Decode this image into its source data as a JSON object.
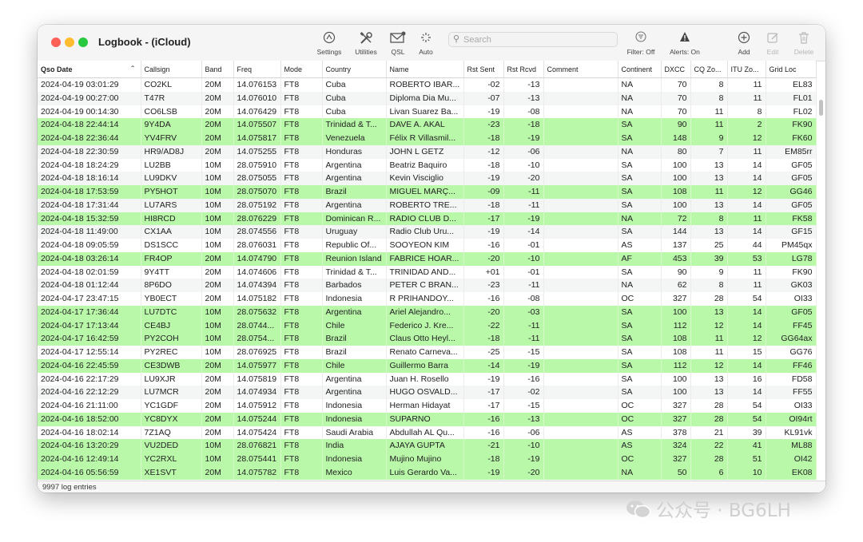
{
  "window": {
    "title": "Logbook - (iCloud)"
  },
  "toolbar": {
    "settings": "Settings",
    "utilities": "Utilities",
    "qsl": "QSL",
    "auto": "Auto",
    "search_placeholder": "Search",
    "filter": "Filter: Off",
    "alerts": "Alerts: On",
    "add": "Add",
    "edit": "Edit",
    "delete": "Delete"
  },
  "table": {
    "columns": [
      "Qso Date",
      "Callsign",
      "Band",
      "Freq",
      "Mode",
      "Country",
      "Name",
      "Rst Sent",
      "Rst Rcvd",
      "Comment",
      "Continent",
      "DXCC",
      "CQ Zo...",
      "ITU Zo...",
      "Grid Loc"
    ],
    "rows": [
      {
        "date": "2024-04-19 03:01:29",
        "call": "CO2KL",
        "band": "20M",
        "freq": "14.076153",
        "mode": "FT8",
        "country": "Cuba",
        "name": "ROBERTO IBAR...",
        "sent": "-02",
        "rcvd": "-13",
        "comment": "",
        "cont": "NA",
        "dxcc": "70",
        "cq": "8",
        "itu": "11",
        "grid": "EL83",
        "hl": false
      },
      {
        "date": "2024-04-19 00:27:00",
        "call": "T47R",
        "band": "20M",
        "freq": "14.076010",
        "mode": "FT8",
        "country": "Cuba",
        "name": "Diploma Dia Mu...",
        "sent": "-07",
        "rcvd": "-13",
        "comment": "",
        "cont": "NA",
        "dxcc": "70",
        "cq": "8",
        "itu": "11",
        "grid": "FL01",
        "hl": false
      },
      {
        "date": "2024-04-19 00:14:30",
        "call": "CO6LSB",
        "band": "20M",
        "freq": "14.076429",
        "mode": "FT8",
        "country": "Cuba",
        "name": "Livan Suarez Ba...",
        "sent": "-19",
        "rcvd": "-08",
        "comment": "",
        "cont": "NA",
        "dxcc": "70",
        "cq": "11",
        "itu": "8",
        "grid": "FL02",
        "hl": false
      },
      {
        "date": "2024-04-18 22:44:14",
        "call": "9Y4DA",
        "band": "20M",
        "freq": "14.075507",
        "mode": "FT8",
        "country": "Trinidad & T...",
        "name": "DAVE A. AKAL",
        "sent": "-23",
        "rcvd": "-18",
        "comment": "",
        "cont": "SA",
        "dxcc": "90",
        "cq": "11",
        "itu": "2",
        "grid": "FK90",
        "hl": true
      },
      {
        "date": "2024-04-18 22:36:44",
        "call": "YV4FRV",
        "band": "20M",
        "freq": "14.075817",
        "mode": "FT8",
        "country": "Venezuela",
        "name": "Félix R Villasmil...",
        "sent": "-18",
        "rcvd": "-19",
        "comment": "",
        "cont": "SA",
        "dxcc": "148",
        "cq": "9",
        "itu": "12",
        "grid": "FK60",
        "hl": true
      },
      {
        "date": "2024-04-18 22:30:59",
        "call": "HR9/AD8J",
        "band": "20M",
        "freq": "14.075255",
        "mode": "FT8",
        "country": "Honduras",
        "name": "JOHN L GETZ",
        "sent": "-12",
        "rcvd": "-06",
        "comment": "",
        "cont": "NA",
        "dxcc": "80",
        "cq": "7",
        "itu": "11",
        "grid": "EM85rr",
        "hl": false
      },
      {
        "date": "2024-04-18 18:24:29",
        "call": "LU2BB",
        "band": "10M",
        "freq": "28.075910",
        "mode": "FT8",
        "country": "Argentina",
        "name": "Beatriz Baquiro",
        "sent": "-18",
        "rcvd": "-10",
        "comment": "",
        "cont": "SA",
        "dxcc": "100",
        "cq": "13",
        "itu": "14",
        "grid": "GF05",
        "hl": false
      },
      {
        "date": "2024-04-18 18:16:14",
        "call": "LU9DKV",
        "band": "10M",
        "freq": "28.075055",
        "mode": "FT8",
        "country": "Argentina",
        "name": "Kevin Visciglio",
        "sent": "-19",
        "rcvd": "-20",
        "comment": "",
        "cont": "SA",
        "dxcc": "100",
        "cq": "13",
        "itu": "14",
        "grid": "GF05",
        "hl": false
      },
      {
        "date": "2024-04-18 17:53:59",
        "call": "PY5HOT",
        "band": "10M",
        "freq": "28.075070",
        "mode": "FT8",
        "country": "Brazil",
        "name": "MIGUEL MARÇ...",
        "sent": "-09",
        "rcvd": "-11",
        "comment": "",
        "cont": "SA",
        "dxcc": "108",
        "cq": "11",
        "itu": "12",
        "grid": "GG46",
        "hl": true
      },
      {
        "date": "2024-04-18 17:31:44",
        "call": "LU7ARS",
        "band": "10M",
        "freq": "28.075192",
        "mode": "FT8",
        "country": "Argentina",
        "name": "ROBERTO TRE...",
        "sent": "-18",
        "rcvd": "-11",
        "comment": "",
        "cont": "SA",
        "dxcc": "100",
        "cq": "13",
        "itu": "14",
        "grid": "GF05",
        "hl": false
      },
      {
        "date": "2024-04-18 15:32:59",
        "call": "HI8RCD",
        "band": "10M",
        "freq": "28.076229",
        "mode": "FT8",
        "country": "Dominican R...",
        "name": "RADIO CLUB D...",
        "sent": "-17",
        "rcvd": "-19",
        "comment": "",
        "cont": "NA",
        "dxcc": "72",
        "cq": "8",
        "itu": "11",
        "grid": "FK58",
        "hl": true
      },
      {
        "date": "2024-04-18 11:49:00",
        "call": "CX1AA",
        "band": "10M",
        "freq": "28.074556",
        "mode": "FT8",
        "country": "Uruguay",
        "name": "Radio Club Uru...",
        "sent": "-19",
        "rcvd": "-14",
        "comment": "",
        "cont": "SA",
        "dxcc": "144",
        "cq": "13",
        "itu": "14",
        "grid": "GF15",
        "hl": false
      },
      {
        "date": "2024-04-18 09:05:59",
        "call": "DS1SCC",
        "band": "10M",
        "freq": "28.076031",
        "mode": "FT8",
        "country": "Republic Of...",
        "name": "SOOYEON KIM",
        "sent": "-16",
        "rcvd": "-01",
        "comment": "",
        "cont": "AS",
        "dxcc": "137",
        "cq": "25",
        "itu": "44",
        "grid": "PM45qx",
        "hl": false
      },
      {
        "date": "2024-04-18 03:26:14",
        "call": "FR4OP",
        "band": "20M",
        "freq": "14.074790",
        "mode": "FT8",
        "country": "Reunion Island",
        "name": "FABRICE HOAR...",
        "sent": "-20",
        "rcvd": "-10",
        "comment": "",
        "cont": "AF",
        "dxcc": "453",
        "cq": "39",
        "itu": "53",
        "grid": "LG78",
        "hl": true
      },
      {
        "date": "2024-04-18 02:01:59",
        "call": "9Y4TT",
        "band": "20M",
        "freq": "14.074606",
        "mode": "FT8",
        "country": "Trinidad & T...",
        "name": "TRINIDAD AND...",
        "sent": "+01",
        "rcvd": "-01",
        "comment": "",
        "cont": "SA",
        "dxcc": "90",
        "cq": "9",
        "itu": "11",
        "grid": "FK90",
        "hl": false
      },
      {
        "date": "2024-04-18 01:12:44",
        "call": "8P6DO",
        "band": "20M",
        "freq": "14.074394",
        "mode": "FT8",
        "country": "Barbados",
        "name": "PETER C BRAN...",
        "sent": "-23",
        "rcvd": "-11",
        "comment": "",
        "cont": "NA",
        "dxcc": "62",
        "cq": "8",
        "itu": "11",
        "grid": "GK03",
        "hl": false
      },
      {
        "date": "2024-04-17 23:47:15",
        "call": "YB0ECT",
        "band": "20M",
        "freq": "14.075182",
        "mode": "FT8",
        "country": "Indonesia",
        "name": "R PRIHANDOY...",
        "sent": "-16",
        "rcvd": "-08",
        "comment": "",
        "cont": "OC",
        "dxcc": "327",
        "cq": "28",
        "itu": "54",
        "grid": "OI33",
        "hl": false
      },
      {
        "date": "2024-04-17 17:36:44",
        "call": "LU7DTC",
        "band": "10M",
        "freq": "28.075632",
        "mode": "FT8",
        "country": "Argentina",
        "name": "Ariel Alejandro...",
        "sent": "-20",
        "rcvd": "-03",
        "comment": "",
        "cont": "SA",
        "dxcc": "100",
        "cq": "13",
        "itu": "14",
        "grid": "GF05",
        "hl": true
      },
      {
        "date": "2024-04-17 17:13:44",
        "call": "CE4BJ",
        "band": "10M",
        "freq": "28.0744...",
        "mode": "FT8",
        "country": "Chile",
        "name": "Federico J. Kre...",
        "sent": "-22",
        "rcvd": "-11",
        "comment": "",
        "cont": "SA",
        "dxcc": "112",
        "cq": "12",
        "itu": "14",
        "grid": "FF45",
        "hl": true
      },
      {
        "date": "2024-04-17 16:42:59",
        "call": "PY2COH",
        "band": "10M",
        "freq": "28.0754...",
        "mode": "FT8",
        "country": "Brazil",
        "name": "Claus Otto Heyl...",
        "sent": "-18",
        "rcvd": "-11",
        "comment": "",
        "cont": "SA",
        "dxcc": "108",
        "cq": "11",
        "itu": "12",
        "grid": "GG64ax",
        "hl": true
      },
      {
        "date": "2024-04-17 12:55:14",
        "call": "PY2REC",
        "band": "10M",
        "freq": "28.076925",
        "mode": "FT8",
        "country": "Brazil",
        "name": "Renato Carneva...",
        "sent": "-25",
        "rcvd": "-15",
        "comment": "",
        "cont": "SA",
        "dxcc": "108",
        "cq": "11",
        "itu": "15",
        "grid": "GG76",
        "hl": false
      },
      {
        "date": "2024-04-16 22:45:59",
        "call": "CE3DWB",
        "band": "20M",
        "freq": "14.075977",
        "mode": "FT8",
        "country": "Chile",
        "name": "Guillermo Barra",
        "sent": "-14",
        "rcvd": "-19",
        "comment": "",
        "cont": "SA",
        "dxcc": "112",
        "cq": "12",
        "itu": "14",
        "grid": "FF46",
        "hl": true
      },
      {
        "date": "2024-04-16 22:17:29",
        "call": "LU9XJR",
        "band": "20M",
        "freq": "14.075819",
        "mode": "FT8",
        "country": "Argentina",
        "name": "Juan H. Rosello",
        "sent": "-19",
        "rcvd": "-16",
        "comment": "",
        "cont": "SA",
        "dxcc": "100",
        "cq": "13",
        "itu": "16",
        "grid": "FD58",
        "hl": false
      },
      {
        "date": "2024-04-16 22:12:29",
        "call": "LU7MCR",
        "band": "20M",
        "freq": "14.074934",
        "mode": "FT8",
        "country": "Argentina",
        "name": "HUGO OSVALD...",
        "sent": "-17",
        "rcvd": "-02",
        "comment": "",
        "cont": "SA",
        "dxcc": "100",
        "cq": "13",
        "itu": "14",
        "grid": "FF55",
        "hl": false
      },
      {
        "date": "2024-04-16 21:11:00",
        "call": "YC1GDF",
        "band": "20M",
        "freq": "14.075912",
        "mode": "FT8",
        "country": "Indonesia",
        "name": "Herman Hidayat",
        "sent": "-17",
        "rcvd": "-15",
        "comment": "",
        "cont": "OC",
        "dxcc": "327",
        "cq": "28",
        "itu": "54",
        "grid": "OI33",
        "hl": false
      },
      {
        "date": "2024-04-16 18:52:00",
        "call": "YC8DYX",
        "band": "20M",
        "freq": "14.075244",
        "mode": "FT8",
        "country": "Indonesia",
        "name": "SUPARNO",
        "sent": "-16",
        "rcvd": "-13",
        "comment": "",
        "cont": "OC",
        "dxcc": "327",
        "cq": "28",
        "itu": "54",
        "grid": "OI94rt",
        "hl": true
      },
      {
        "date": "2024-04-16 18:02:14",
        "call": "7Z1AQ",
        "band": "20M",
        "freq": "14.075424",
        "mode": "FT8",
        "country": "Saudi Arabia",
        "name": "Abdullah AL Qu...",
        "sent": "-16",
        "rcvd": "-06",
        "comment": "",
        "cont": "AS",
        "dxcc": "378",
        "cq": "21",
        "itu": "39",
        "grid": "KL91vk",
        "hl": false
      },
      {
        "date": "2024-04-16 13:20:29",
        "call": "VU2DED",
        "band": "10M",
        "freq": "28.076821",
        "mode": "FT8",
        "country": "India",
        "name": "AJAYA GUPTA",
        "sent": "-21",
        "rcvd": "-10",
        "comment": "",
        "cont": "AS",
        "dxcc": "324",
        "cq": "22",
        "itu": "41",
        "grid": "ML88",
        "hl": true
      },
      {
        "date": "2024-04-16 12:49:14",
        "call": "YC2RXL",
        "band": "10M",
        "freq": "28.075441",
        "mode": "FT8",
        "country": "Indonesia",
        "name": "Mujino Mujino",
        "sent": "-18",
        "rcvd": "-19",
        "comment": "",
        "cont": "OC",
        "dxcc": "327",
        "cq": "28",
        "itu": "51",
        "grid": "OI42",
        "hl": true
      },
      {
        "date": "2024-04-16 05:56:59",
        "call": "XE1SVT",
        "band": "20M",
        "freq": "14.075782",
        "mode": "FT8",
        "country": "Mexico",
        "name": "Luis Gerardo Va...",
        "sent": "-19",
        "rcvd": "-20",
        "comment": "",
        "cont": "NA",
        "dxcc": "50",
        "cq": "6",
        "itu": "10",
        "grid": "EK08",
        "hl": true
      }
    ]
  },
  "status": {
    "entries": "9997 log entries"
  },
  "watermark": {
    "text": "公众号 · BG6LH"
  },
  "colors": {
    "highlight": "#b9f7a9",
    "close": "#fe5f57",
    "minimize": "#febc2e",
    "zoom": "#28c840"
  },
  "icons": {
    "settings": "gauge-icon",
    "utilities": "tools-icon",
    "qsl": "envelope-icon",
    "auto": "sparkle-icon",
    "search": "search-icon",
    "filter": "filter-icon",
    "alerts": "warning-icon",
    "add": "plus-circle-icon",
    "edit": "edit-icon",
    "delete": "trash-icon",
    "sort": "chevron-up-icon"
  }
}
